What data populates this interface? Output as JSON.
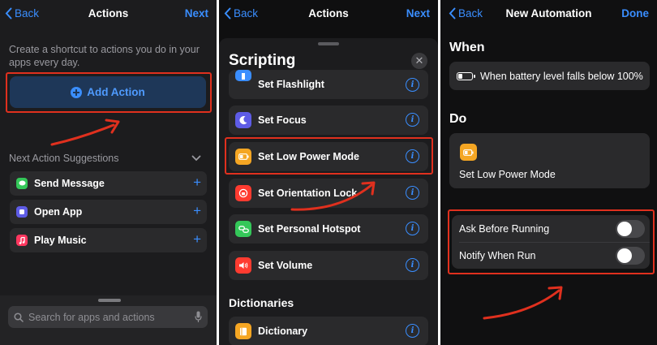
{
  "colors": {
    "accent": "#3a8eff",
    "highlight": "#e0301e",
    "low_power": "#f5a623"
  },
  "panel1": {
    "back": "Back",
    "title": "Actions",
    "next": "Next",
    "intro": "Create a shortcut to actions you do in your apps every day.",
    "add_action": "Add Action",
    "suggestions_title": "Next Action Suggestions",
    "suggestions": [
      {
        "label": "Send Message",
        "icon": "message-icon",
        "color": "#34c759"
      },
      {
        "label": "Open App",
        "icon": "app-icon",
        "color": "#5e5ce6"
      },
      {
        "label": "Play Music",
        "icon": "music-icon",
        "color": "#ff375f"
      }
    ],
    "search_placeholder": "Search for apps and actions"
  },
  "panel2": {
    "back": "Back",
    "title": "Actions",
    "next": "Next",
    "sheet_title": "Scripting",
    "actions": [
      {
        "label": "Set Flashlight",
        "icon": "flashlight-icon",
        "color": "#3a8eff"
      },
      {
        "label": "Set Focus",
        "icon": "moon-icon",
        "color": "#5e5ce6"
      },
      {
        "label": "Set Low Power Mode",
        "icon": "battery-icon",
        "color": "#f5a623"
      },
      {
        "label": "Set Orientation Lock",
        "icon": "orientation-lock-icon",
        "color": "#ff3b30"
      },
      {
        "label": "Set Personal Hotspot",
        "icon": "hotspot-icon",
        "color": "#34c759"
      },
      {
        "label": "Set Volume",
        "icon": "speaker-icon",
        "color": "#ff3b30"
      }
    ],
    "section2": "Dictionaries",
    "dictionary": {
      "label": "Dictionary",
      "icon": "dictionary-icon",
      "color": "#f5a623"
    }
  },
  "panel3": {
    "back": "Back",
    "title": "New Automation",
    "done": "Done",
    "when_heading": "When",
    "when_text": "When battery level falls below 100%",
    "battery_level": 0.35,
    "do_heading": "Do",
    "do_action": "Set Low Power Mode",
    "ask_before_running": "Ask Before Running",
    "ask_before_running_on": false,
    "notify_when_run": "Notify When Run",
    "notify_when_run_on": false
  }
}
